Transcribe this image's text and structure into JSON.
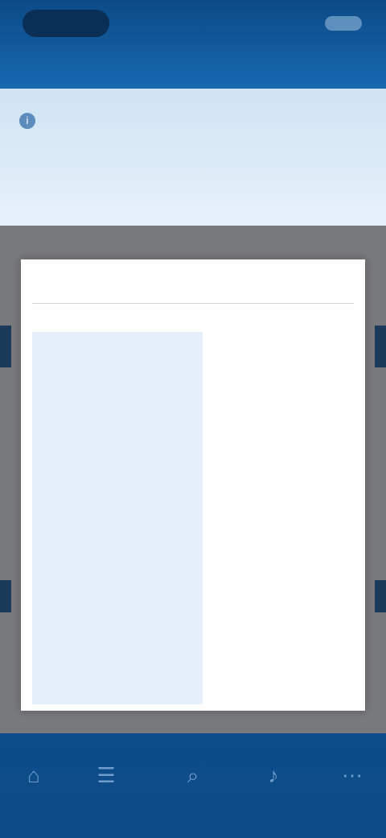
{
  "header": {
    "title": ""
  },
  "notice": {
    "icon": "info-icon",
    "lines": [
      "",
      "",
      ""
    ]
  },
  "card": {
    "title": "",
    "rows": [
      {
        "label": "",
        "value": ""
      },
      {
        "label": "",
        "value": ""
      },
      {
        "label": "",
        "value": ""
      },
      {
        "label": "",
        "value": ""
      },
      {
        "label": "",
        "value": ""
      },
      {
        "label": "",
        "value": ""
      },
      {
        "label": "",
        "value": ""
      }
    ]
  },
  "nav": {
    "items": [
      {
        "icon": "home-icon"
      },
      {
        "icon": "list-icon"
      },
      {
        "icon": "search-icon"
      },
      {
        "icon": "bell-icon"
      },
      {
        "icon": "menu-icon"
      }
    ]
  },
  "colors": {
    "header": "#0c4a86",
    "notice_bg": "#dfeefb",
    "label_bg": "#e4effa",
    "overlay": "#77797c",
    "nav": "#0e4a87"
  }
}
